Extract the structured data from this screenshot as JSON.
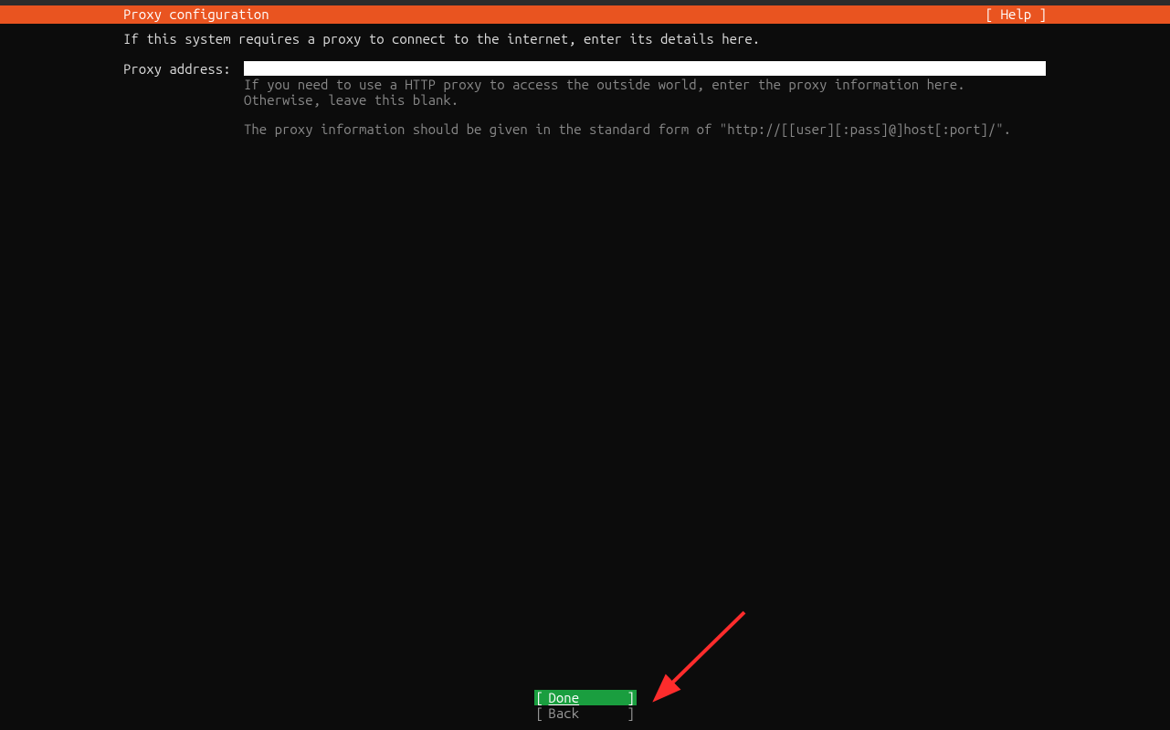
{
  "header": {
    "title": "Proxy configuration",
    "help_label": "[ Help ]"
  },
  "intro": "If this system requires a proxy to connect to the internet, enter its details here.",
  "form": {
    "proxy_label": "Proxy address:",
    "proxy_value": "",
    "help_line1": "If you need to use a HTTP proxy to access the outside world, enter the proxy information here. Otherwise, leave this blank.",
    "help_line2": "The proxy information should be given in the standard form of \"http://[[user][:pass]@]host[:port]/\"."
  },
  "buttons": {
    "done": "Done",
    "back": "Back",
    "bracket_left": "[",
    "bracket_right": "]"
  },
  "colors": {
    "header_bg": "#e95420",
    "done_bg": "#1a9e3f",
    "arrow": "#fd2c2c"
  }
}
